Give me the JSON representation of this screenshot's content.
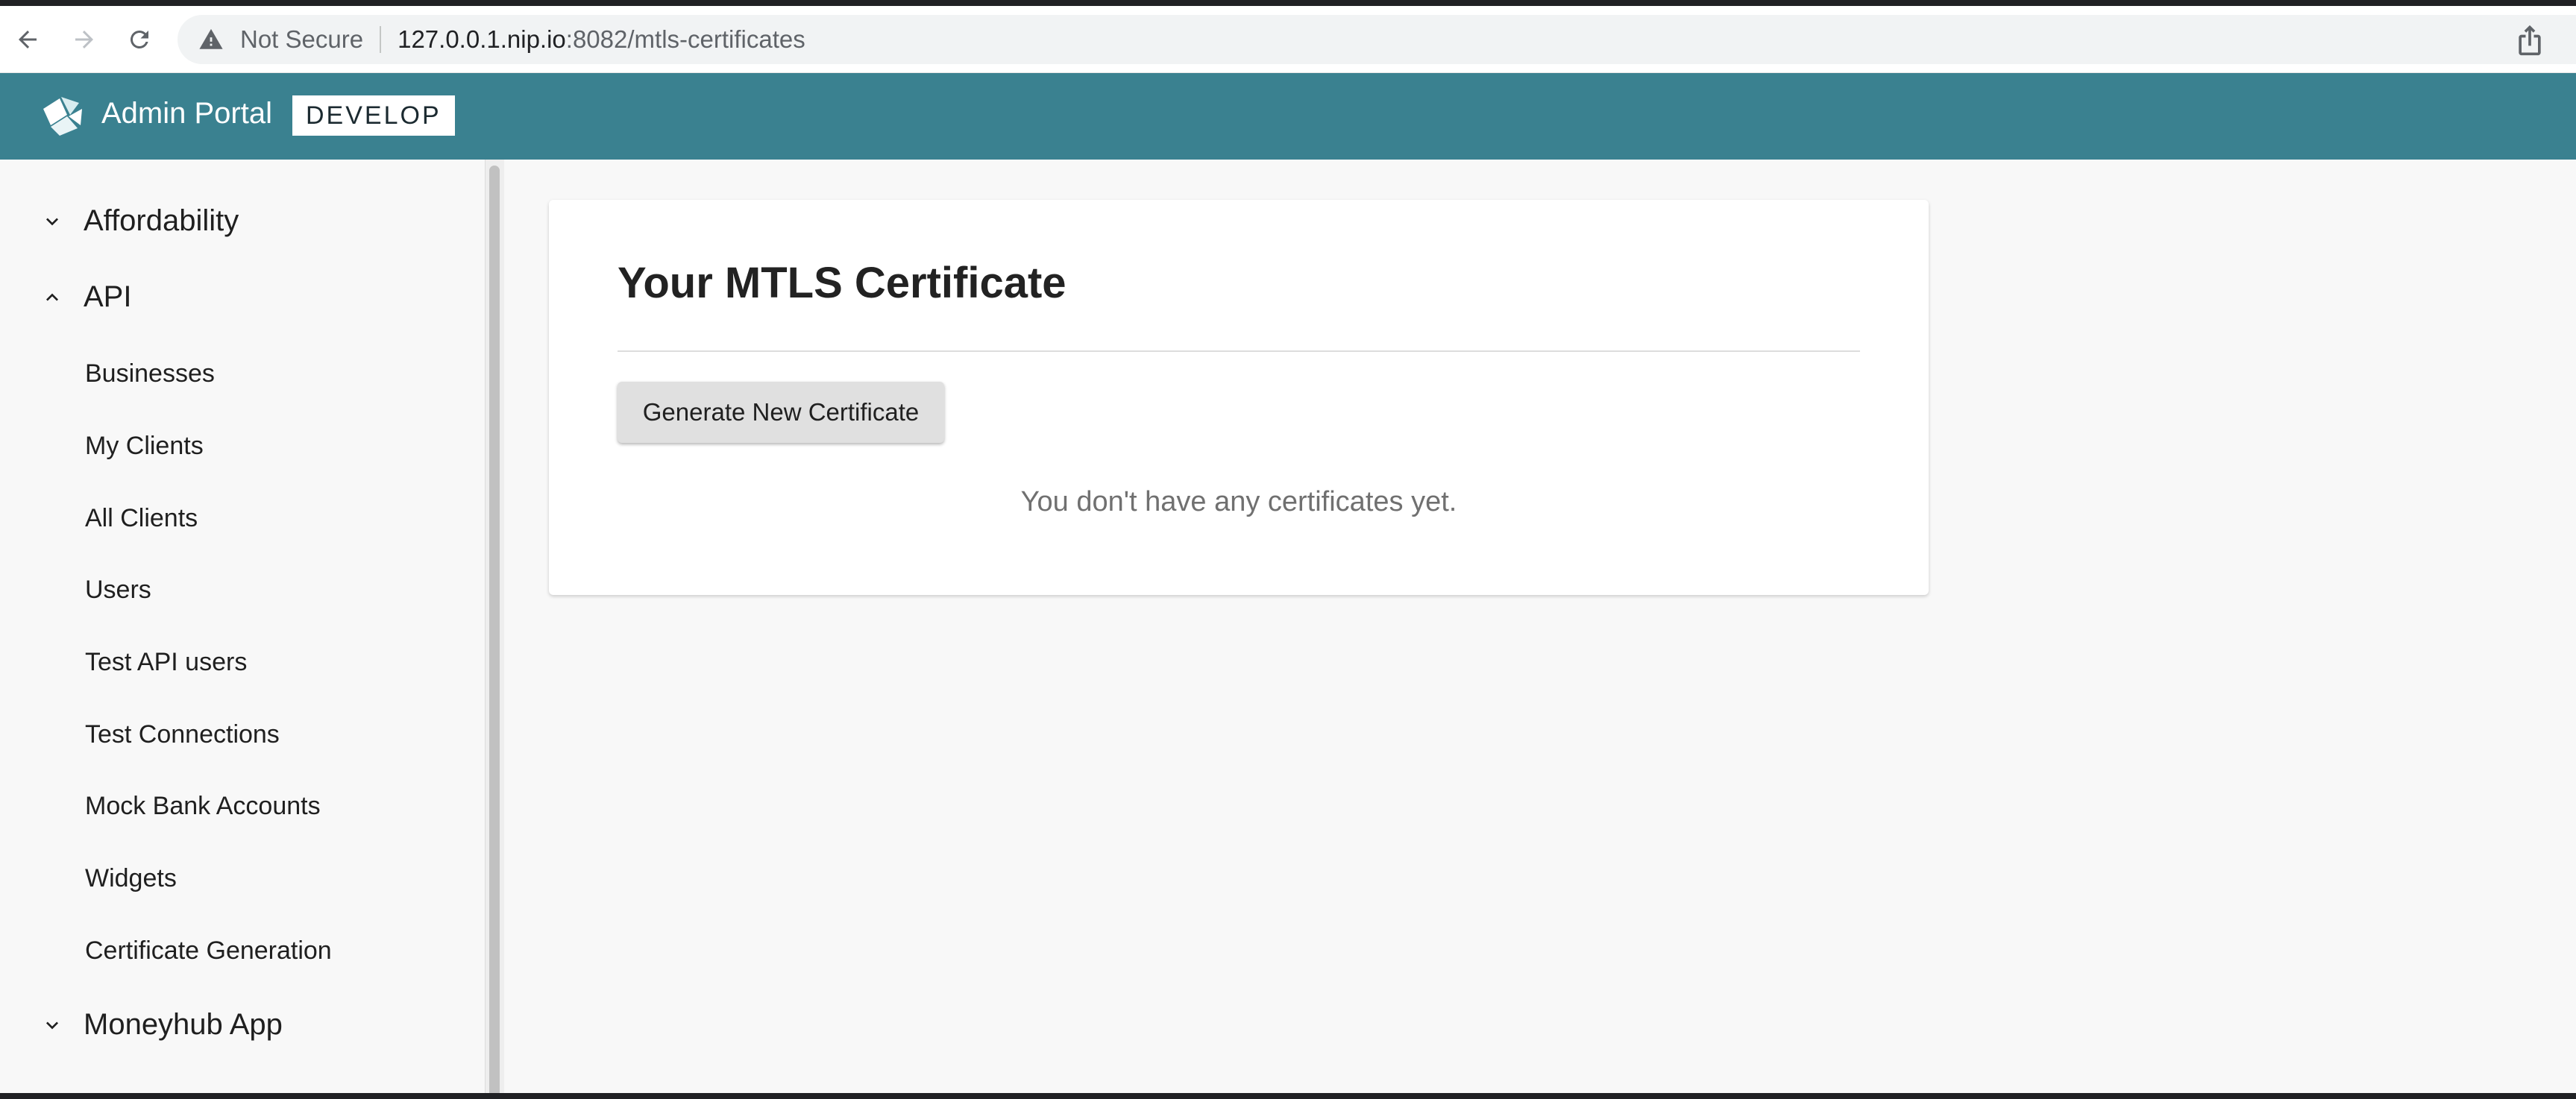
{
  "browser": {
    "security_label": "Not Secure",
    "url_host": "127.0.0.1.nip.io",
    "url_path": ":8082/mtls-certificates"
  },
  "header": {
    "title": "Admin Portal",
    "env_badge": "DEVELOP",
    "brand_color": "#3a8190"
  },
  "sidebar": {
    "sections": [
      {
        "label": "Affordability",
        "expanded": false
      },
      {
        "label": "API",
        "expanded": true
      },
      {
        "label": "Moneyhub App",
        "expanded": false
      }
    ],
    "api_items": [
      "Businesses",
      "My Clients",
      "All Clients",
      "Users",
      "Test API users",
      "Test Connections",
      "Mock Bank Accounts",
      "Widgets",
      "Certificate Generation"
    ]
  },
  "main": {
    "title": "Your MTLS Certificate",
    "generate_button": "Generate New Certificate",
    "empty_message": "You don't have any certificates yet."
  }
}
